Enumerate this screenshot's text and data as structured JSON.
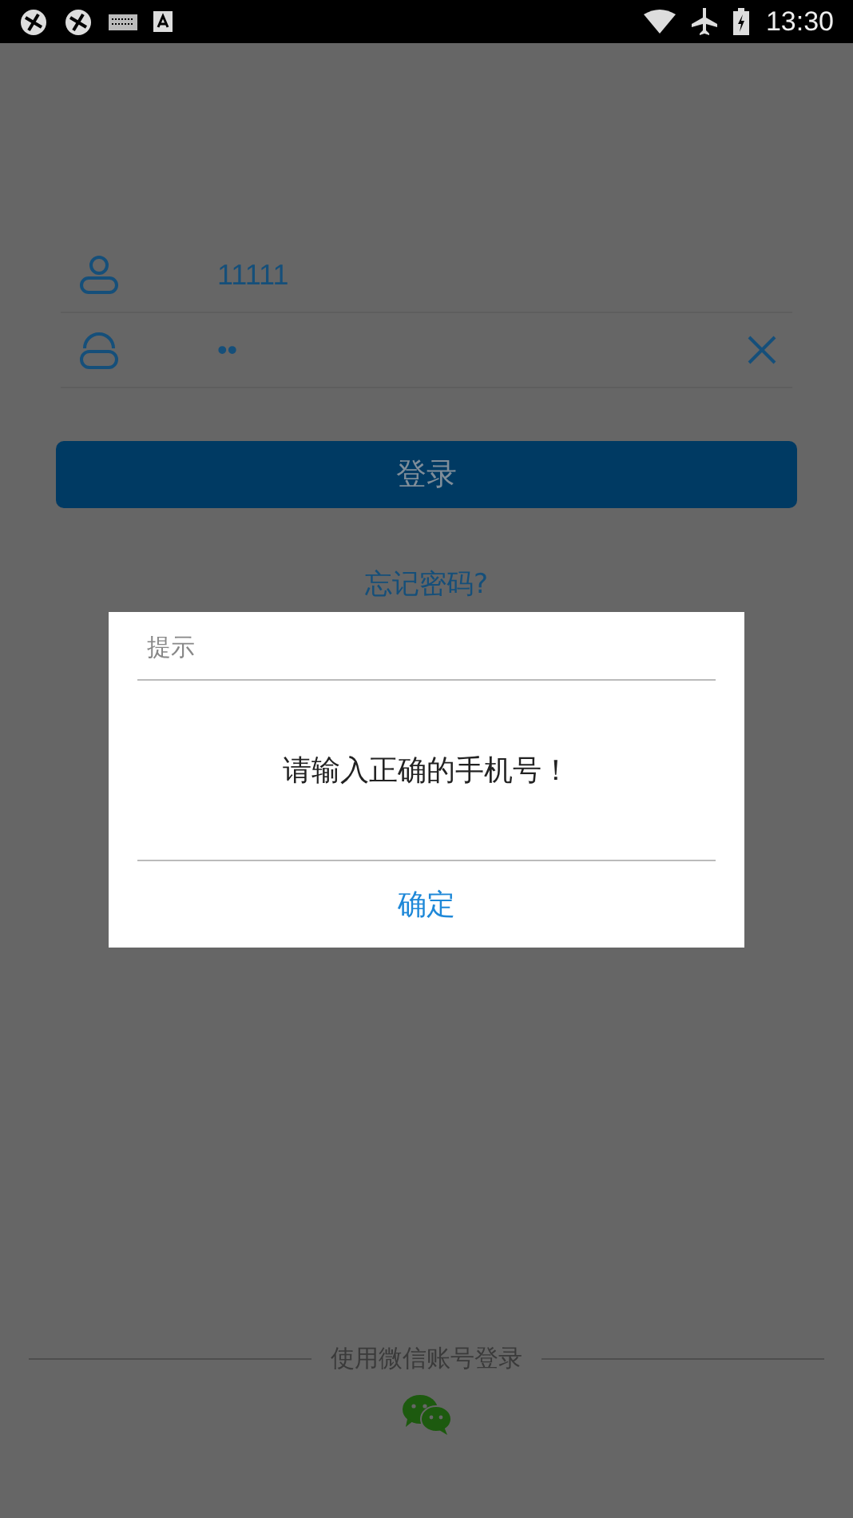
{
  "status_bar": {
    "time": "13:30"
  },
  "login_form": {
    "username": {
      "value": "11111"
    },
    "password": {
      "value": "••"
    },
    "login_button": "登录",
    "forgot_password": "忘记密码?"
  },
  "wechat_login": {
    "label": "使用微信账号登录"
  },
  "dialog": {
    "title": "提示",
    "message": "请输入正确的手机号！",
    "confirm_button": "确定"
  }
}
